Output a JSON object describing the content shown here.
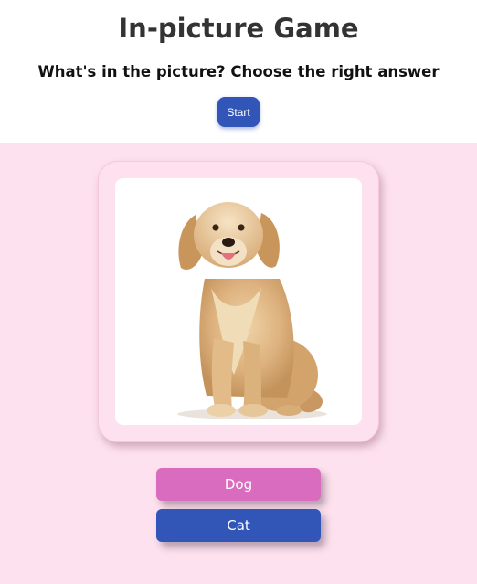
{
  "header": {
    "title": "In-picture Game",
    "subtitle": "What's in the picture? Choose the right answer",
    "start_label": "Start"
  },
  "picture": {
    "subject_icon": "golden-retriever-dog-image"
  },
  "answers": [
    {
      "label": "Dog",
      "color": "#d96cbf"
    },
    {
      "label": "Cat",
      "color": "#3256b8"
    }
  ],
  "colors": {
    "game_background": "#fde1ee",
    "primary": "#3256b8",
    "accent": "#d96cbf"
  }
}
